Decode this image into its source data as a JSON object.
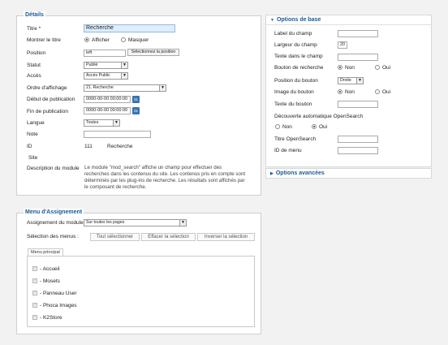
{
  "details": {
    "legend": "Détails",
    "title_label": "Titre *",
    "title_value": "Recherche",
    "show_title_label": "Montrer le titre",
    "show_title_on": "Afficher",
    "show_title_off": "Masquer",
    "position_label": "Position",
    "position_value": "left",
    "position_button": "Sélectionnez la position",
    "status_label": "Statut",
    "status_value": "Publié",
    "access_label": "Accès",
    "access_value": "Accès Public",
    "order_label": "Ordre d'affichage",
    "order_value": "21. Recherche",
    "publish_up_label": "Début de publication",
    "publish_up_value": "0000-00-00 00:00:00",
    "publish_down_label": "Fin de publication",
    "publish_down_value": "0000-00-00 00:00:00",
    "language_label": "Langue",
    "language_value": "Toutes",
    "note_label": "Note",
    "note_value": "",
    "id_label": "ID",
    "id_value": "111",
    "module_name": "Recherche",
    "site_label": "Site",
    "description_label": "Description du module",
    "description_text": "Le module \"mod_search\" affiche un champ pour effectuer des recherches dans les contenus du site. Les contenus pris en compte sont déterminés par les plug-ins de recherche. Les résultats sont affichés par le composant de recherche.",
    "calendar_icon_text": "31"
  },
  "assignment": {
    "legend": "Menu d'Assignement",
    "module_assignment_label": "Assignement du module",
    "module_assignment_value": "Sur toutes les pages",
    "menu_selection_label": "Sélection des menus :",
    "select_all": "Tout sélectionner",
    "clear_selection": "Effacer la sélection",
    "invert_selection": "Inverser la sélection",
    "tab_main_menu": "Menu principal",
    "items": [
      "- Accueil",
      "- Mosets",
      "- Panneau User",
      "- Phoca Images",
      "- K2Store"
    ]
  },
  "basic_options": {
    "header": "Options de base",
    "field_label": "Label du champ",
    "field_label_value": "",
    "field_width": "Largeur du champ",
    "field_width_value": "20",
    "field_text": "Texte dans le champ",
    "field_text_value": "",
    "search_button": "Bouton de recherche",
    "no": "Non",
    "yes": "Oui",
    "button_position": "Position du bouton",
    "button_position_value": "Droite",
    "button_image": "Image du bouton",
    "button_text": "Texte du bouton",
    "button_text_value": "",
    "opensearch_discovery": "Découverte automatique OpenSearch",
    "opensearch_title": "Titre OpenSearch",
    "opensearch_title_value": "",
    "menu_id": "ID de menu",
    "menu_id_value": ""
  },
  "advanced_options": {
    "header": "Options avancées"
  },
  "colors": {
    "accent": "#1b5a98",
    "title_input_bg": "#dfeefb"
  }
}
